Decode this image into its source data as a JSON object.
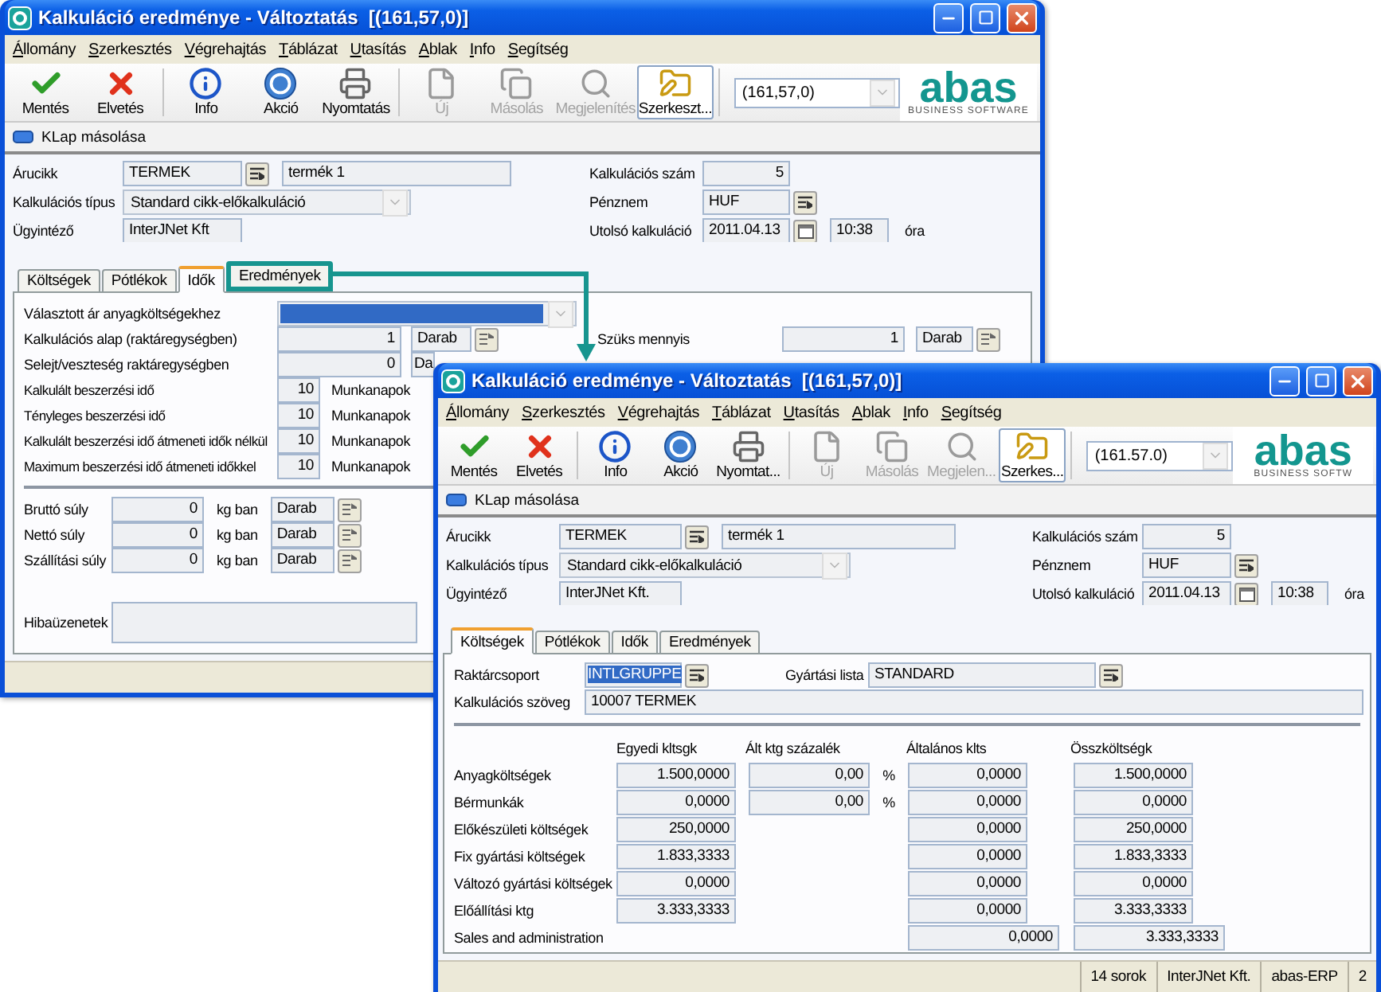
{
  "back_window": {
    "title": "Kalkuláció eredménye - Változtatás  [(161,57,0)]",
    "menu": [
      "Állomány",
      "Szerkesztés",
      "Végrehajtás",
      "Táblázat",
      "Utasítás",
      "Ablak",
      "Info",
      "Segítség"
    ],
    "toolbar": [
      [
        {
          "label": "Mentés",
          "kind": "save",
          "disabled": false,
          "pressed": false
        },
        {
          "label": "Elvetés",
          "kind": "discard",
          "disabled": false,
          "pressed": false
        }
      ],
      [
        {
          "label": "Info",
          "kind": "info",
          "disabled": false,
          "pressed": false
        },
        {
          "label": "Akció",
          "kind": "action",
          "disabled": false,
          "pressed": false
        },
        {
          "label": "Nyomtatás",
          "kind": "print",
          "disabled": false,
          "pressed": false
        }
      ],
      [
        {
          "label": "Új",
          "kind": "new",
          "disabled": true,
          "pressed": false
        },
        {
          "label": "Másolás",
          "kind": "copy",
          "disabled": true,
          "pressed": false
        },
        {
          "label": "Megjelenítés",
          "kind": "view",
          "disabled": true,
          "pressed": false
        },
        {
          "label": "Szerkeszt...",
          "kind": "edit",
          "disabled": false,
          "pressed": true
        }
      ]
    ],
    "combo": "(161,57,0)",
    "logo": {
      "name": "abas",
      "tagline": "BUSINESS SOFTWARE"
    },
    "klap": "KLap másolása",
    "header": {
      "article": {
        "label": "Árucikk",
        "code": "TERMEK",
        "name": "termék 1"
      },
      "type": {
        "label": "Kalkulációs típus",
        "value": "Standard cikk-előkalkuláció"
      },
      "clerk": {
        "label": "Ügyintéző",
        "value": "InterJNet Kft"
      },
      "number": {
        "label": "Kalkulációs szám",
        "value": "5"
      },
      "currency": {
        "label": "Pénznem",
        "value": "HUF"
      },
      "last": {
        "label": "Utolsó kalkuláció",
        "date": "2011.04.13",
        "time": "10:38",
        "unit": "óra"
      }
    },
    "tabs": [
      {
        "label": "Költségek",
        "selected": false,
        "highlighted": false
      },
      {
        "label": "Pótlékok",
        "selected": false,
        "highlighted": false
      },
      {
        "label": "Idők",
        "selected": true,
        "highlighted": false
      },
      {
        "label": "Eredmények",
        "selected": false,
        "highlighted": true
      }
    ],
    "times_panel": {
      "price_choice": {
        "label": "Választott ár anyagköltségekhez",
        "focused": true
      },
      "base": {
        "label": "Kalkulációs alap (raktáregységben)",
        "value": "1",
        "unit": "Darab"
      },
      "required": {
        "label": "Szüks mennyis",
        "value": "1",
        "unit": "Darab"
      },
      "scrap": {
        "label": "Selejt/veszteség raktáregységben",
        "value": "0",
        "unit": "Da"
      },
      "durations": [
        {
          "label": "Kalkulált beszerzési idő",
          "value": "10",
          "unit": "Munkanapok"
        },
        {
          "label": "Tényleges beszerzési idő",
          "value": "10",
          "unit": "Munkanapok"
        },
        {
          "label": "Kalkulált beszerzési idő átmeneti idők nélkül",
          "value": "10",
          "unit": "Munkanapok"
        },
        {
          "label": "Maximum beszerzési idő átmeneti időkkel",
          "value": "10",
          "unit": "Munkanapok"
        }
      ],
      "weights": [
        {
          "label": "Bruttó súly",
          "value": "0",
          "per": "kg ban",
          "unit": "Darab"
        },
        {
          "label": "Nettó súly",
          "value": "0",
          "per": "kg ban",
          "unit": "Darab"
        },
        {
          "label": "Szállítási súly",
          "value": "0",
          "per": "kg ban",
          "unit": "Darab"
        }
      ],
      "errors": {
        "label": "Hibaüzenetek"
      }
    }
  },
  "front_window": {
    "title": "Kalkuláció eredménye - Változtatás  [(161,57,0)]",
    "menu": [
      "Állomány",
      "Szerkesztés",
      "Végrehajtás",
      "Táblázat",
      "Utasítás",
      "Ablak",
      "Info",
      "Segítség"
    ],
    "toolbar": [
      [
        {
          "label": "Mentés",
          "kind": "save",
          "disabled": false,
          "pressed": false
        },
        {
          "label": "Elvetés",
          "kind": "discard",
          "disabled": false,
          "pressed": false
        }
      ],
      [
        {
          "label": "Info",
          "kind": "info",
          "disabled": false,
          "pressed": false
        },
        {
          "label": "Akció",
          "kind": "action",
          "disabled": false,
          "pressed": false
        },
        {
          "label": "Nyomtat...",
          "kind": "print",
          "disabled": false,
          "pressed": false
        }
      ],
      [
        {
          "label": "Új",
          "kind": "new",
          "disabled": true,
          "pressed": false
        },
        {
          "label": "Másolás",
          "kind": "copy",
          "disabled": true,
          "pressed": false
        },
        {
          "label": "Megjelen...",
          "kind": "view",
          "disabled": true,
          "pressed": false
        },
        {
          "label": "Szerkes...",
          "kind": "edit",
          "disabled": false,
          "pressed": true
        }
      ]
    ],
    "combo": "(161.57.0)",
    "logo": {
      "name": "abas",
      "tagline": "BUSINESS SOFTW"
    },
    "klap": "KLap másolása",
    "header": {
      "article": {
        "label": "Árucikk",
        "code": "TERMEK",
        "name": "termék 1"
      },
      "type": {
        "label": "Kalkulációs típus",
        "value": "Standard cikk-előkalkuláció"
      },
      "clerk": {
        "label": "Ügyintéző",
        "value": "InterJNet Kft."
      },
      "number": {
        "label": "Kalkulációs szám",
        "value": "5"
      },
      "currency": {
        "label": "Pénznem",
        "value": "HUF"
      },
      "last": {
        "label": "Utolsó kalkuláció",
        "date": "2011.04.13",
        "time": "10:38",
        "unit": "óra"
      }
    },
    "tabs": [
      {
        "label": "Költségek",
        "selected": true,
        "highlighted": false
      },
      {
        "label": "Pótlékok",
        "selected": false,
        "highlighted": false
      },
      {
        "label": "Idők",
        "selected": false,
        "highlighted": false
      },
      {
        "label": "Eredmények",
        "selected": false,
        "highlighted": false
      }
    ],
    "costs_panel": {
      "stock_group": {
        "label": "Raktárcsoport",
        "value": "INTLGRUPPE",
        "text_selected": true
      },
      "bom": {
        "label": "Gyártási lista",
        "value": "STANDARD"
      },
      "text": {
        "label": "Kalkulációs szöveg",
        "value": "10007 TERMEK"
      },
      "columns": [
        "Egyedi kltsgk",
        "Ált ktg százalék",
        "Általános klts",
        "Összköltségk"
      ],
      "rows": [
        {
          "kind": "cost",
          "label": "Anyagköltségek",
          "unit_cost": "1.500,0000",
          "pct": "0,00",
          "pct_sign": "%",
          "overhead": "0,0000",
          "total": "1.500,0000"
        },
        {
          "kind": "cost",
          "label": "Bérmunkák",
          "unit_cost": "0,0000",
          "pct": "0,00",
          "pct_sign": "%",
          "overhead": "0,0000",
          "total": "0,0000"
        },
        {
          "kind": "cost",
          "label": "Előkészületi költségek",
          "unit_cost": "250,0000",
          "overhead": "0,0000",
          "total": "250,0000"
        },
        {
          "kind": "cost",
          "label": "Fix gyártási költségek",
          "unit_cost": "1.833,3333",
          "overhead": "0,0000",
          "total": "1.833,3333"
        },
        {
          "kind": "cost",
          "label": "Változó gyártási költségek",
          "unit_cost": "0,0000",
          "overhead": "0,0000",
          "total": "0,0000"
        },
        {
          "kind": "cost",
          "label": "Előállítási ktg",
          "unit_cost": "3.333,3333",
          "overhead": "0,0000",
          "total": "3.333,3333"
        },
        {
          "kind": "summary",
          "label": "Sales and administration",
          "overhead": "0,0000",
          "total": "3.333,3333"
        }
      ]
    },
    "status_bar": [
      "14 sorok",
      "InterJNet Kft.",
      "abas-ERP",
      "2"
    ]
  }
}
